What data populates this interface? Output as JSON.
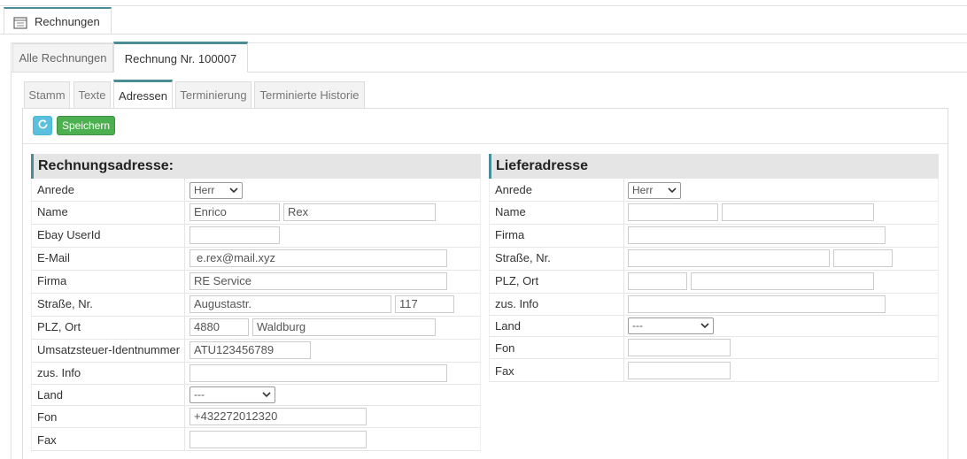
{
  "main_tab": {
    "label": "Rechnungen"
  },
  "tabs": [
    {
      "label": "Alle Rechnungen",
      "active": false
    },
    {
      "label": "Rechnung Nr. 100007",
      "active": true
    }
  ],
  "subtabs": [
    {
      "label": "Stamm",
      "active": false
    },
    {
      "label": "Texte",
      "active": false
    },
    {
      "label": "Adressen",
      "active": true
    },
    {
      "label": "Terminierung",
      "active": false
    },
    {
      "label": "Terminierte Historie",
      "active": false
    }
  ],
  "toolbar": {
    "refresh_icon": "refresh-icon",
    "save_label": "Speichern"
  },
  "billing": {
    "title": "Rechnungsadresse:",
    "labels": {
      "anrede": "Anrede",
      "name": "Name",
      "ebay": "Ebay UserId",
      "email": "E-Mail",
      "firma": "Firma",
      "strasse": "Straße, Nr.",
      "plz": "PLZ, Ort",
      "ust": "Umsatzsteuer-Identnummer",
      "info": "zus. Info",
      "land": "Land",
      "fon": "Fon",
      "fax": "Fax"
    },
    "values": {
      "anrede": "Herr",
      "firstname": "Enrico",
      "lastname": "Rex",
      "ebay": "",
      "email": "e.rex@mail.xyz",
      "firma": "RE Service",
      "street": "Augustastr.",
      "number": "117",
      "zip": "4880",
      "city": "Waldburg",
      "ust": "ATU123456789",
      "info": "",
      "land": "---",
      "fon": "+432272012320",
      "fax": ""
    }
  },
  "delivery": {
    "title": "Lieferadresse",
    "labels": {
      "anrede": "Anrede",
      "name": "Name",
      "firma": "Firma",
      "strasse": "Straße, Nr.",
      "plz": "PLZ, Ort",
      "info": "zus. Info",
      "land": "Land",
      "fon": "Fon",
      "fax": "Fax"
    },
    "values": {
      "anrede": "Herr",
      "firstname": "",
      "lastname": "",
      "firma": "",
      "street": "",
      "number": "",
      "zip": "",
      "city": "",
      "info": "",
      "land": "---",
      "fon": "",
      "fax": ""
    }
  },
  "colors": {
    "accent": "#4a8d96",
    "save": "#4caf50",
    "refresh": "#5bc0de"
  }
}
